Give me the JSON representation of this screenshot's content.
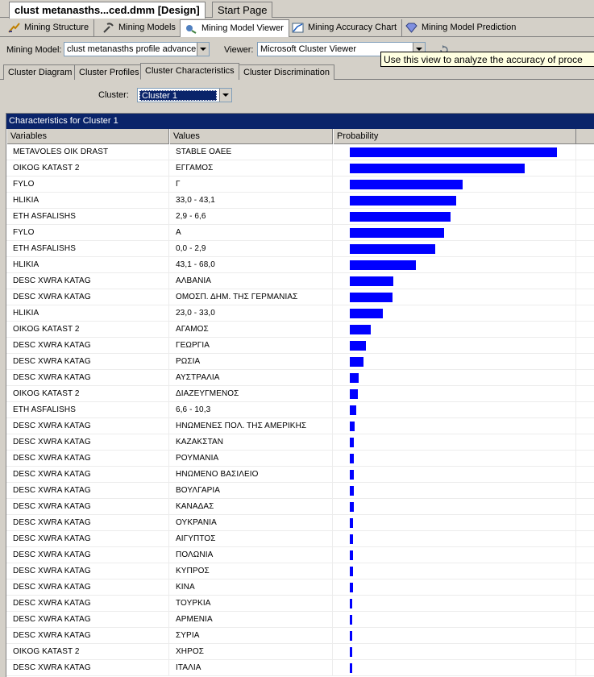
{
  "doc_tabs": [
    "clust metanasths...ced.dmm [Design]",
    "Start Page"
  ],
  "designer_tabs": [
    {
      "label": "Mining Structure",
      "icon": "mining-structure-icon"
    },
    {
      "label": "Mining Models",
      "icon": "mining-models-icon"
    },
    {
      "label": "Mining Model Viewer",
      "icon": "mining-model-viewer-icon"
    },
    {
      "label": "Mining Accuracy Chart",
      "icon": "mining-accuracy-chart-icon"
    },
    {
      "label": "Mining Model Prediction",
      "icon": "mining-model-prediction-icon"
    }
  ],
  "model_row": {
    "mining_model_label": "Mining Model:",
    "mining_model_value": "clust metanasths profile advance",
    "viewer_label": "Viewer:",
    "viewer_value": "Microsoft Cluster Viewer"
  },
  "tooltip": "Use this view to analyze the accuracy of proce",
  "viewer_tabs": [
    "Cluster Diagram",
    "Cluster Profiles",
    "Cluster Characteristics",
    "Cluster Discrimination"
  ],
  "cluster": {
    "label": "Cluster:",
    "value": "Cluster 1"
  },
  "panel_title": "Characteristics for Cluster 1",
  "columns": [
    "Variables",
    "Values",
    "Probability"
  ],
  "colors": {
    "bar": "#0000ff",
    "title_bar": "#0a246a"
  },
  "rows": [
    {
      "variable": "METAVOLES OIK DRAST",
      "value": "STABLE OAEE",
      "probability": 0.98
    },
    {
      "variable": "OIKOG KATAST 2",
      "value": "ΕΓΓΑΜΟΣ",
      "probability": 0.83
    },
    {
      "variable": "FYLO",
      "value": "Γ",
      "probability": 0.533
    },
    {
      "variable": "HLIKIA",
      "value": "33,0 - 43,1",
      "probability": 0.503
    },
    {
      "variable": "ETH ASFALISHS",
      "value": "2,9 - 6,6",
      "probability": 0.477
    },
    {
      "variable": "FYLO",
      "value": "Α",
      "probability": 0.446
    },
    {
      "variable": "ETH ASFALISHS",
      "value": "0,0 - 2,9",
      "probability": 0.404
    },
    {
      "variable": "HLIKIA",
      "value": "43,1 - 68,0",
      "probability": 0.312
    },
    {
      "variable": "DESC XWRA KATAG",
      "value": "ΑΛΒΑΝΙΑ",
      "probability": 0.206
    },
    {
      "variable": "DESC XWRA KATAG",
      "value": "ΟΜΟΣΠ. ΔΗΜ. ΤΗΣ ΓΕΡΜΑΝΙΑΣ",
      "probability": 0.202
    },
    {
      "variable": "HLIKIA",
      "value": "23,0 - 33,0",
      "probability": 0.156
    },
    {
      "variable": "OIKOG KATAST 2",
      "value": "ΑΓΑΜΟΣ",
      "probability": 0.099
    },
    {
      "variable": "DESC XWRA KATAG",
      "value": "ΓΕΩΡΓΙΑ",
      "probability": 0.076
    },
    {
      "variable": "DESC XWRA KATAG",
      "value": "ΡΩΣΙΑ",
      "probability": 0.065
    },
    {
      "variable": "DESC XWRA KATAG",
      "value": "ΑΥΣΤΡΑΛΙΑ",
      "probability": 0.042
    },
    {
      "variable": "OIKOG KATAST 2",
      "value": "ΔΙΑΖΕΥΓΜΕΝΟΣ",
      "probability": 0.038
    },
    {
      "variable": "ETH ASFALISHS",
      "value": "6,6 - 10,3",
      "probability": 0.03
    },
    {
      "variable": "DESC XWRA KATAG",
      "value": "ΗΝΩΜΕΝΕΣ ΠΟΛ. ΤΗΣ ΑΜΕΡΙΚΗΣ",
      "probability": 0.023
    },
    {
      "variable": "DESC XWRA KATAG",
      "value": "ΚΑΖΑΚΣΤΑΝ",
      "probability": 0.019
    },
    {
      "variable": "DESC XWRA KATAG",
      "value": "ΡΟΥΜΑΝΙΑ",
      "probability": 0.019
    },
    {
      "variable": "DESC XWRA KATAG",
      "value": "ΗΝΩΜΕΝΟ ΒΑΣΙΛΕΙΟ",
      "probability": 0.019
    },
    {
      "variable": "DESC XWRA KATAG",
      "value": "ΒΟΥΛΓΑΡΙΑ",
      "probability": 0.019
    },
    {
      "variable": "DESC XWRA KATAG",
      "value": "ΚΑΝΑΔΑΣ",
      "probability": 0.019
    },
    {
      "variable": "DESC XWRA KATAG",
      "value": "ΟΥΚΡΑΝΙΑ",
      "probability": 0.015
    },
    {
      "variable": "DESC XWRA KATAG",
      "value": "ΑΙΓΥΠΤΟΣ",
      "probability": 0.015
    },
    {
      "variable": "DESC XWRA KATAG",
      "value": "ΠΟΛΩΝΙΑ",
      "probability": 0.015
    },
    {
      "variable": "DESC XWRA KATAG",
      "value": "ΚΥΠΡΟΣ",
      "probability": 0.015
    },
    {
      "variable": "DESC XWRA KATAG",
      "value": "ΚΙΝΑ",
      "probability": 0.015
    },
    {
      "variable": "DESC XWRA KATAG",
      "value": "ΤΟΥΡΚΙΑ",
      "probability": 0.011
    },
    {
      "variable": "DESC XWRA KATAG",
      "value": "ΑΡΜΕΝΙΑ",
      "probability": 0.011
    },
    {
      "variable": "DESC XWRA KATAG",
      "value": "ΣΥΡΙΑ",
      "probability": 0.011
    },
    {
      "variable": "OIKOG KATAST 2",
      "value": "ΧΗΡΟΣ",
      "probability": 0.008
    },
    {
      "variable": "DESC XWRA KATAG",
      "value": "ΙΤΑΛΙΑ",
      "probability": 0.008
    }
  ]
}
